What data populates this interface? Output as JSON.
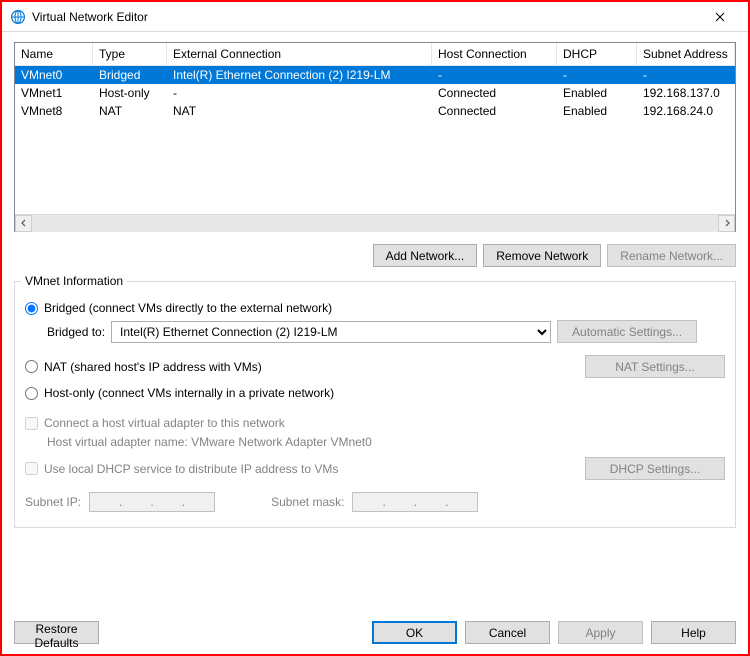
{
  "window": {
    "title": "Virtual Network Editor"
  },
  "table": {
    "headers": {
      "name": "Name",
      "type": "Type",
      "ext": "External Connection",
      "host": "Host Connection",
      "dhcp": "DHCP",
      "subnet": "Subnet Address"
    },
    "rows": [
      {
        "name": "VMnet0",
        "type": "Bridged",
        "ext": "Intel(R) Ethernet Connection (2) I219-LM",
        "host": "-",
        "dhcp": "-",
        "subnet": "-",
        "selected": true
      },
      {
        "name": "VMnet1",
        "type": "Host-only",
        "ext": "-",
        "host": "Connected",
        "dhcp": "Enabled",
        "subnet": "192.168.137.0",
        "selected": false
      },
      {
        "name": "VMnet8",
        "type": "NAT",
        "ext": "NAT",
        "host": "Connected",
        "dhcp": "Enabled",
        "subnet": "192.168.24.0",
        "selected": false
      }
    ]
  },
  "buttons": {
    "add": "Add Network...",
    "remove": "Remove Network",
    "rename": "Rename Network..."
  },
  "group": {
    "title": "VMnet Information",
    "bridged_radio": "Bridged (connect VMs directly to the external network)",
    "bridged_to_label": "Bridged to:",
    "bridged_to_value": "Intel(R) Ethernet Connection (2) I219-LM",
    "auto_settings": "Automatic Settings...",
    "nat_radio": "NAT (shared host's IP address with VMs)",
    "nat_settings": "NAT Settings...",
    "hostonly_radio": "Host-only (connect VMs internally in a private network)",
    "connect_host_adapter": "Connect a host virtual adapter to this network",
    "host_adapter_name_label": "Host virtual adapter name: VMware Network Adapter VMnet0",
    "use_dhcp": "Use local DHCP service to distribute IP address to VMs",
    "dhcp_settings": "DHCP Settings...",
    "subnet_ip_label": "Subnet IP:",
    "subnet_mask_label": "Subnet mask:"
  },
  "footer": {
    "restore": "Restore Defaults",
    "ok": "OK",
    "cancel": "Cancel",
    "apply": "Apply",
    "help": "Help"
  }
}
